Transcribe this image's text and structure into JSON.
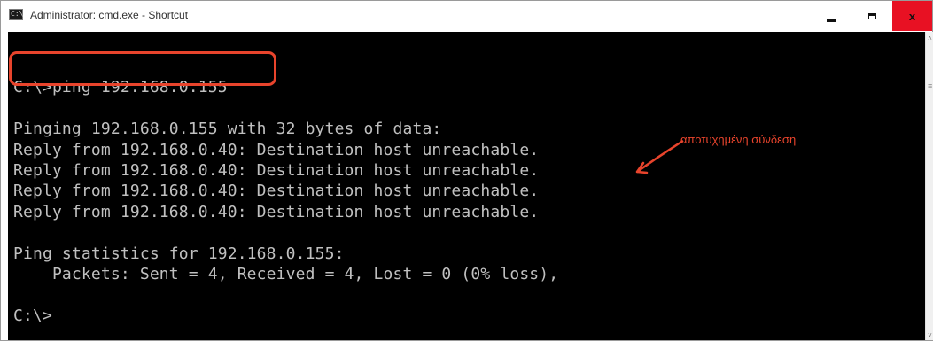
{
  "window": {
    "title": "Administrator: cmd.exe - Shortcut",
    "icon": "cmd-icon",
    "icon_glyph": "C:\\"
  },
  "controls": {
    "minimize": "minimize-icon",
    "maximize": "maximize-icon",
    "close": "close-icon",
    "close_glyph": "x",
    "close_color": "#e81123"
  },
  "console": {
    "background": "#000000",
    "text_color": "#c0c0c0",
    "lines": [
      "",
      "C:\\>ping 192.168.0.155",
      "",
      "Pinging 192.168.0.155 with 32 bytes of data:",
      "Reply from 192.168.0.40: Destination host unreachable.",
      "Reply from 192.168.0.40: Destination host unreachable.",
      "Reply from 192.168.0.40: Destination host unreachable.",
      "Reply from 192.168.0.40: Destination host unreachable.",
      "",
      "Ping statistics for 192.168.0.155:",
      "    Packets: Sent = 4, Received = 4, Lost = 0 (0% loss),",
      "",
      "C:\\>"
    ]
  },
  "annotation": {
    "text": "αποτυχημένη σύνδεση",
    "color": "#e8442c"
  },
  "scrollbar": {
    "up": "˄",
    "down": "˅",
    "thumb": "≡"
  }
}
